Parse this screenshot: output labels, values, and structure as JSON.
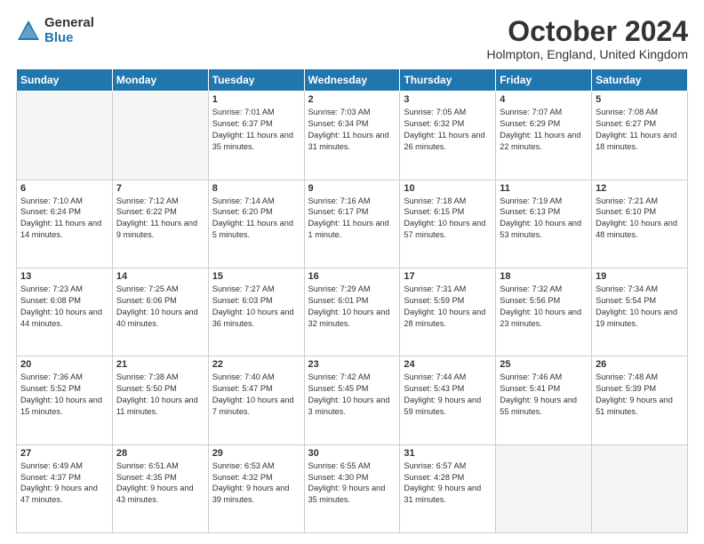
{
  "logo": {
    "general": "General",
    "blue": "Blue"
  },
  "title": "October 2024",
  "location": "Holmpton, England, United Kingdom",
  "headers": [
    "Sunday",
    "Monday",
    "Tuesday",
    "Wednesday",
    "Thursday",
    "Friday",
    "Saturday"
  ],
  "weeks": [
    [
      {
        "day": "",
        "info": ""
      },
      {
        "day": "",
        "info": ""
      },
      {
        "day": "1",
        "info": "Sunrise: 7:01 AM\nSunset: 6:37 PM\nDaylight: 11 hours and 35 minutes."
      },
      {
        "day": "2",
        "info": "Sunrise: 7:03 AM\nSunset: 6:34 PM\nDaylight: 11 hours and 31 minutes."
      },
      {
        "day": "3",
        "info": "Sunrise: 7:05 AM\nSunset: 6:32 PM\nDaylight: 11 hours and 26 minutes."
      },
      {
        "day": "4",
        "info": "Sunrise: 7:07 AM\nSunset: 6:29 PM\nDaylight: 11 hours and 22 minutes."
      },
      {
        "day": "5",
        "info": "Sunrise: 7:08 AM\nSunset: 6:27 PM\nDaylight: 11 hours and 18 minutes."
      }
    ],
    [
      {
        "day": "6",
        "info": "Sunrise: 7:10 AM\nSunset: 6:24 PM\nDaylight: 11 hours and 14 minutes."
      },
      {
        "day": "7",
        "info": "Sunrise: 7:12 AM\nSunset: 6:22 PM\nDaylight: 11 hours and 9 minutes."
      },
      {
        "day": "8",
        "info": "Sunrise: 7:14 AM\nSunset: 6:20 PM\nDaylight: 11 hours and 5 minutes."
      },
      {
        "day": "9",
        "info": "Sunrise: 7:16 AM\nSunset: 6:17 PM\nDaylight: 11 hours and 1 minute."
      },
      {
        "day": "10",
        "info": "Sunrise: 7:18 AM\nSunset: 6:15 PM\nDaylight: 10 hours and 57 minutes."
      },
      {
        "day": "11",
        "info": "Sunrise: 7:19 AM\nSunset: 6:13 PM\nDaylight: 10 hours and 53 minutes."
      },
      {
        "day": "12",
        "info": "Sunrise: 7:21 AM\nSunset: 6:10 PM\nDaylight: 10 hours and 48 minutes."
      }
    ],
    [
      {
        "day": "13",
        "info": "Sunrise: 7:23 AM\nSunset: 6:08 PM\nDaylight: 10 hours and 44 minutes."
      },
      {
        "day": "14",
        "info": "Sunrise: 7:25 AM\nSunset: 6:06 PM\nDaylight: 10 hours and 40 minutes."
      },
      {
        "day": "15",
        "info": "Sunrise: 7:27 AM\nSunset: 6:03 PM\nDaylight: 10 hours and 36 minutes."
      },
      {
        "day": "16",
        "info": "Sunrise: 7:29 AM\nSunset: 6:01 PM\nDaylight: 10 hours and 32 minutes."
      },
      {
        "day": "17",
        "info": "Sunrise: 7:31 AM\nSunset: 5:59 PM\nDaylight: 10 hours and 28 minutes."
      },
      {
        "day": "18",
        "info": "Sunrise: 7:32 AM\nSunset: 5:56 PM\nDaylight: 10 hours and 23 minutes."
      },
      {
        "day": "19",
        "info": "Sunrise: 7:34 AM\nSunset: 5:54 PM\nDaylight: 10 hours and 19 minutes."
      }
    ],
    [
      {
        "day": "20",
        "info": "Sunrise: 7:36 AM\nSunset: 5:52 PM\nDaylight: 10 hours and 15 minutes."
      },
      {
        "day": "21",
        "info": "Sunrise: 7:38 AM\nSunset: 5:50 PM\nDaylight: 10 hours and 11 minutes."
      },
      {
        "day": "22",
        "info": "Sunrise: 7:40 AM\nSunset: 5:47 PM\nDaylight: 10 hours and 7 minutes."
      },
      {
        "day": "23",
        "info": "Sunrise: 7:42 AM\nSunset: 5:45 PM\nDaylight: 10 hours and 3 minutes."
      },
      {
        "day": "24",
        "info": "Sunrise: 7:44 AM\nSunset: 5:43 PM\nDaylight: 9 hours and 59 minutes."
      },
      {
        "day": "25",
        "info": "Sunrise: 7:46 AM\nSunset: 5:41 PM\nDaylight: 9 hours and 55 minutes."
      },
      {
        "day": "26",
        "info": "Sunrise: 7:48 AM\nSunset: 5:39 PM\nDaylight: 9 hours and 51 minutes."
      }
    ],
    [
      {
        "day": "27",
        "info": "Sunrise: 6:49 AM\nSunset: 4:37 PM\nDaylight: 9 hours and 47 minutes."
      },
      {
        "day": "28",
        "info": "Sunrise: 6:51 AM\nSunset: 4:35 PM\nDaylight: 9 hours and 43 minutes."
      },
      {
        "day": "29",
        "info": "Sunrise: 6:53 AM\nSunset: 4:32 PM\nDaylight: 9 hours and 39 minutes."
      },
      {
        "day": "30",
        "info": "Sunrise: 6:55 AM\nSunset: 4:30 PM\nDaylight: 9 hours and 35 minutes."
      },
      {
        "day": "31",
        "info": "Sunrise: 6:57 AM\nSunset: 4:28 PM\nDaylight: 9 hours and 31 minutes."
      },
      {
        "day": "",
        "info": ""
      },
      {
        "day": "",
        "info": ""
      }
    ]
  ]
}
